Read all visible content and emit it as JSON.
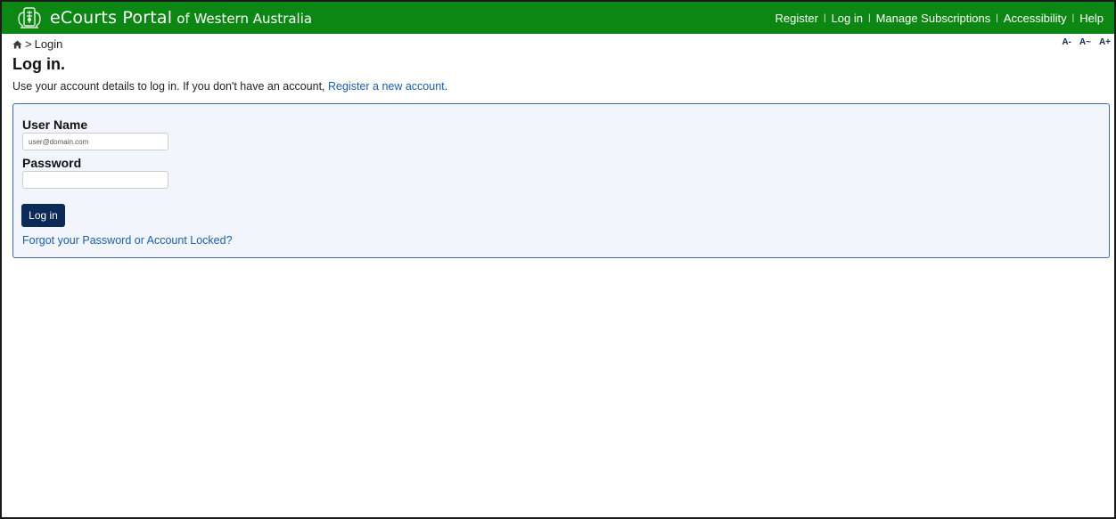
{
  "header": {
    "brand_main": "eCourts Portal",
    "brand_sub": "of Western Australia",
    "nav": [
      "Register",
      "Log in",
      "Manage Subscriptions",
      "Accessibility",
      "Help"
    ],
    "separator": "|",
    "bar_color": "#0d8713"
  },
  "breadcrumb": {
    "home_icon": "home-icon",
    "separator": ">",
    "current": "Login"
  },
  "font_controls": [
    "A-",
    "A~",
    "A+"
  ],
  "page": {
    "title": "Log in.",
    "intro_text": "Use your account details to log in. If you don't have an account, ",
    "intro_link": "Register a new account",
    "intro_end": "."
  },
  "form": {
    "username_label": "User Name",
    "username_placeholder": "user@domain.com",
    "username_value": "",
    "password_label": "Password",
    "password_value": "",
    "submit_label": "Log in",
    "forgot_link": "Forgot your Password or Account Locked?"
  },
  "colors": {
    "panel_border": "#3b6aa8",
    "button": "#0b2a55",
    "link": "#1a5fa8"
  }
}
